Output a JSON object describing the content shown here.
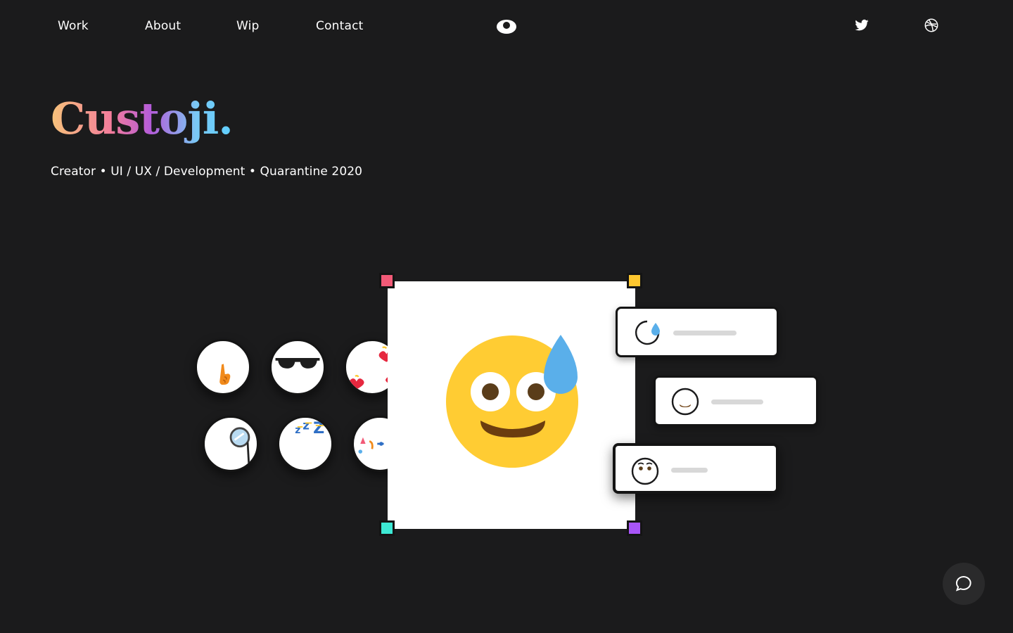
{
  "nav": {
    "links": [
      "Work",
      "About",
      "Wip",
      "Contact"
    ],
    "logo_icon": "eye-icon",
    "social": [
      "twitter-icon",
      "dribbble-icon"
    ]
  },
  "hero": {
    "title": "Custoji.",
    "subtitle": "Creator • UI / UX / Development • Quarantine 2020"
  },
  "emoji_picker": {
    "items": [
      "pointing-hand",
      "sunglasses",
      "hearts",
      "monocle",
      "sleeping-zzz",
      "party"
    ]
  },
  "canvas": {
    "emoji": "grinning-face-with-sweat",
    "handle_colors": [
      "#f25a77",
      "#fdc72f",
      "#3de8d4",
      "#a855f7"
    ]
  },
  "layers": {
    "items": [
      "sweat-drop-layer",
      "smile-mouth-layer",
      "eyes-layer"
    ]
  },
  "colors": {
    "background": "#1b1b1c",
    "emoji_yellow": "#ffcc33",
    "drop_blue": "#5aafea"
  },
  "chat": {
    "icon": "chat-bubble-icon"
  }
}
